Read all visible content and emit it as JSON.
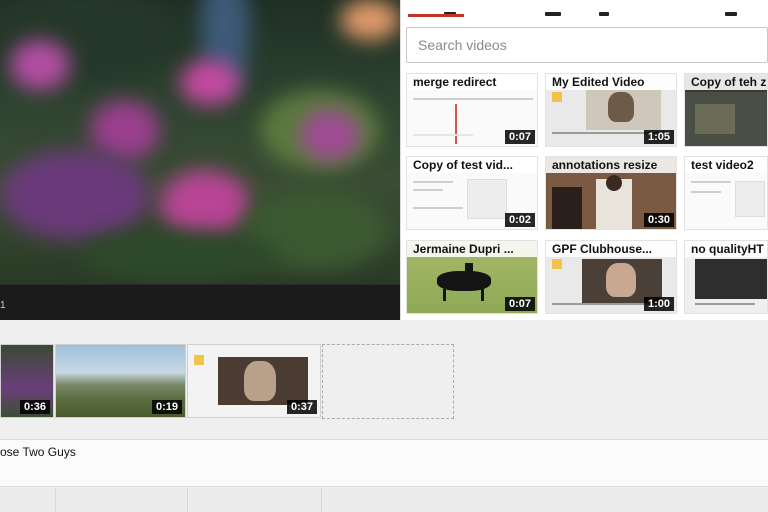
{
  "player": {
    "time_readout": "1"
  },
  "search": {
    "placeholder": "Search videos"
  },
  "videos": [
    {
      "title": "merge redirect",
      "duration": "0:07"
    },
    {
      "title": "My Edited Video",
      "duration": "1:05"
    },
    {
      "title": "Copy of teh z",
      "duration": ""
    },
    {
      "title": "Copy of test vid...",
      "duration": "0:02"
    },
    {
      "title": "annotations resize",
      "duration": "0:30"
    },
    {
      "title": "test video2",
      "duration": ""
    },
    {
      "title": "Jermaine Dupri ...",
      "duration": "0:07"
    },
    {
      "title": "GPF Clubhouse...",
      "duration": "1:00"
    },
    {
      "title": "no qualityHT",
      "duration": ""
    }
  ],
  "timeline": {
    "clips": [
      {
        "duration": "0:36"
      },
      {
        "duration": "0:19"
      },
      {
        "duration": "0:37"
      }
    ],
    "audio_label": "ose Two Guys"
  },
  "colors": {
    "accent": "#c4302b",
    "duration_badge": "#000000"
  }
}
